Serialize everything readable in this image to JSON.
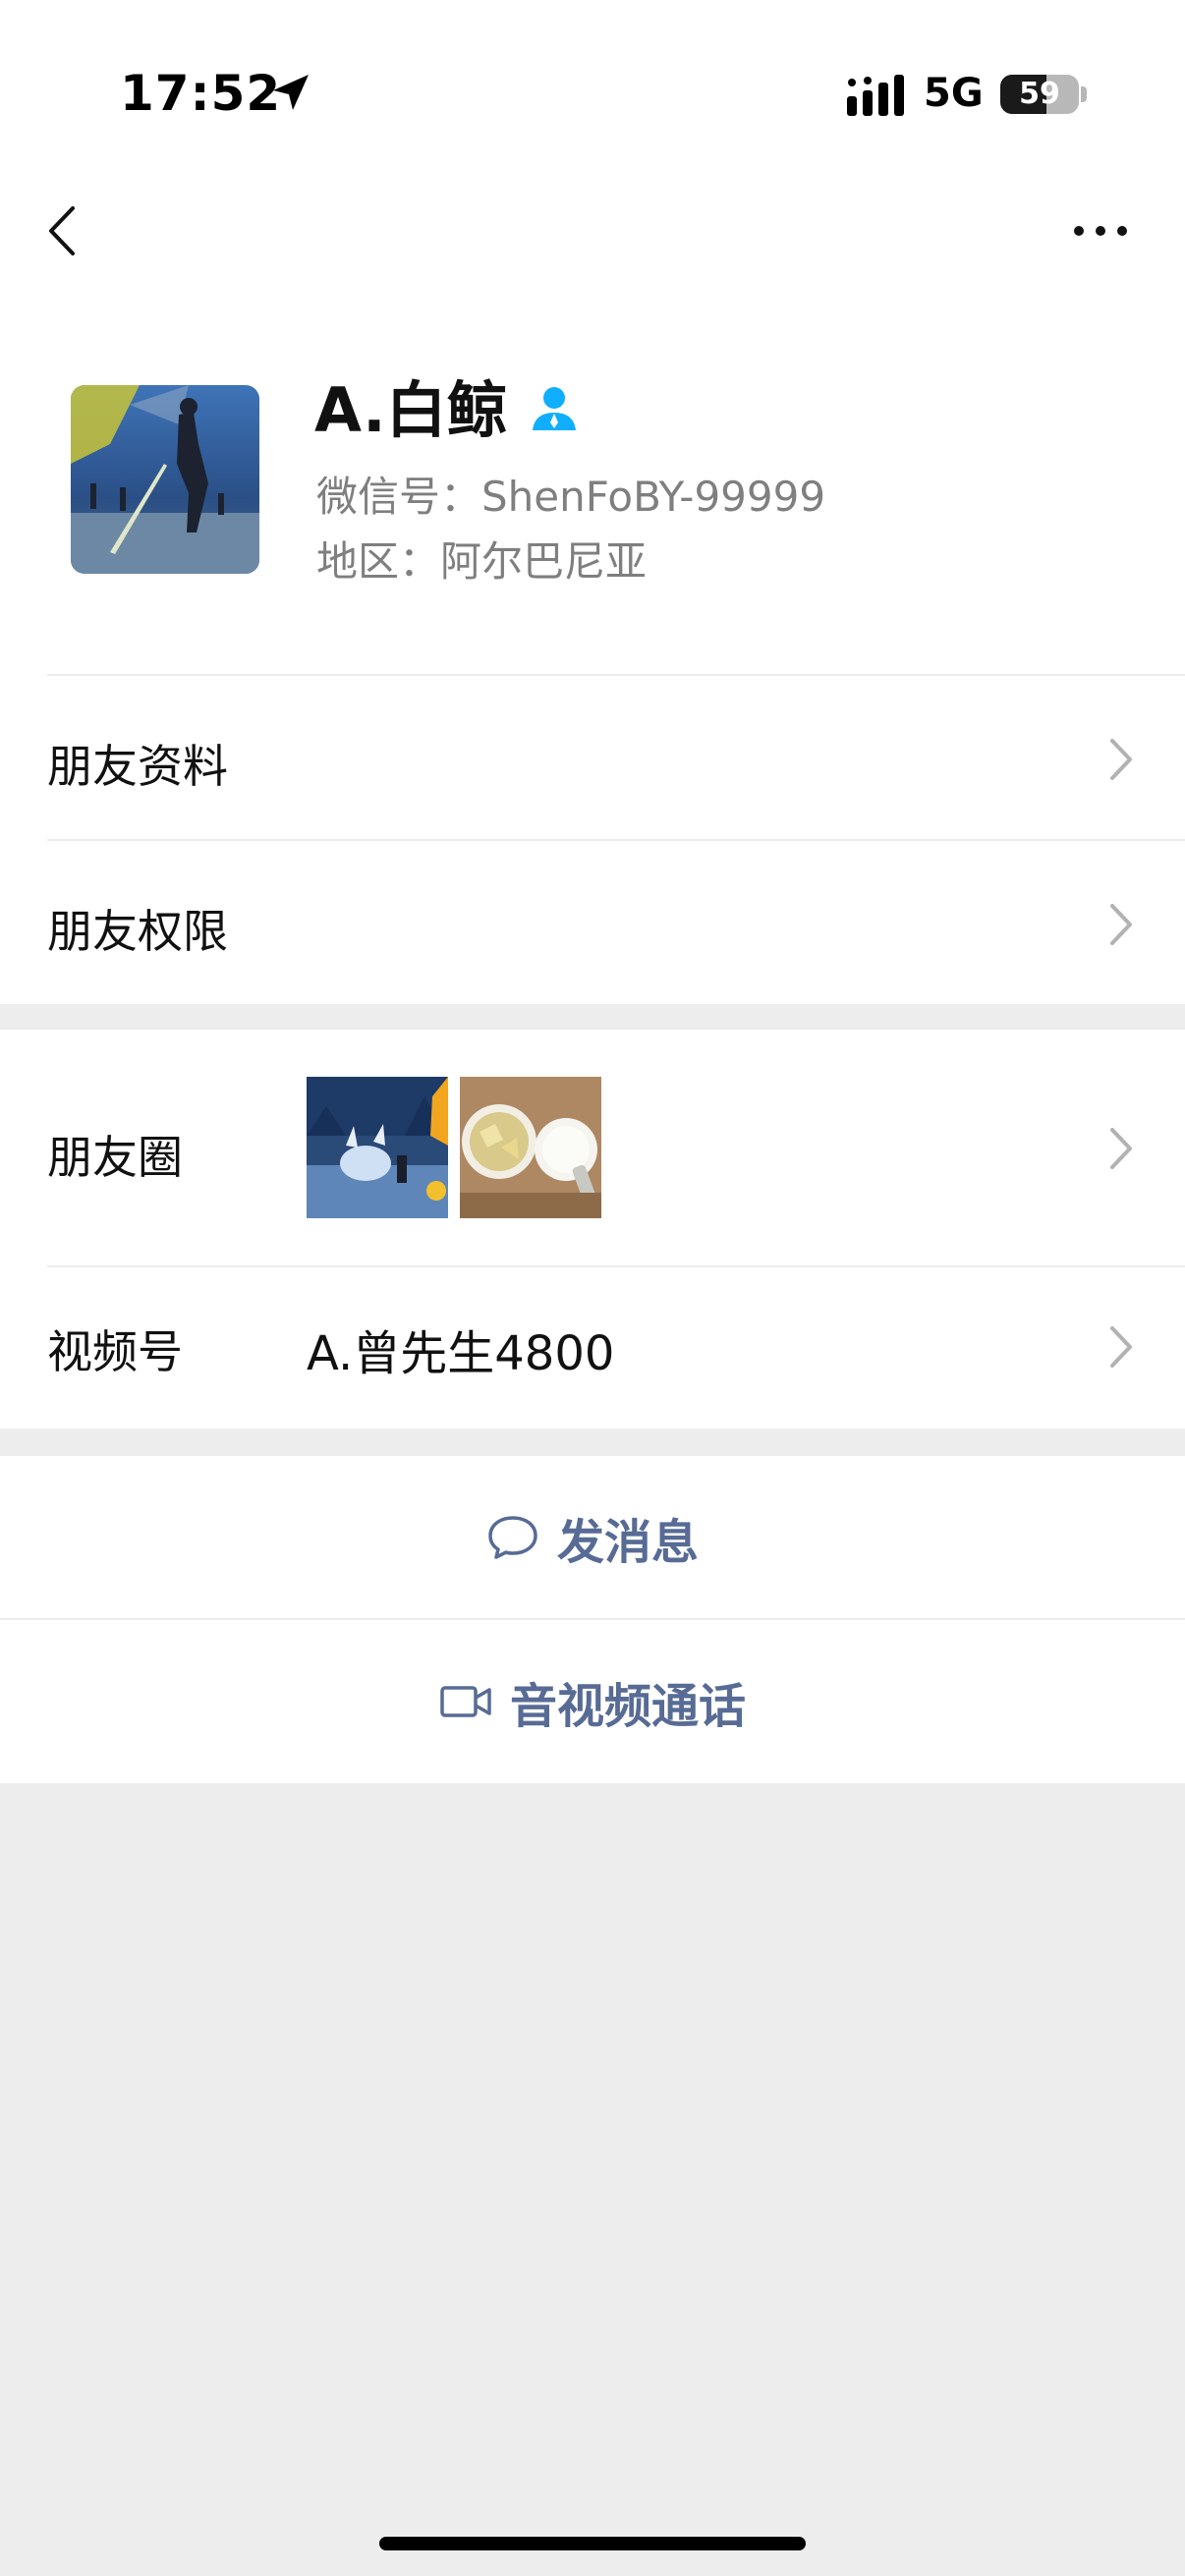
{
  "status_bar": {
    "time": "17:52",
    "network": "5G",
    "battery": "59",
    "battery_level": 0.59
  },
  "profile": {
    "name": "A.白鲸",
    "wechat_id": "微信号：ShenFoBY-99999",
    "region": "地区：阿尔巴尼亚"
  },
  "menu": {
    "friend_info": "朋友资料",
    "friend_permissions": "朋友权限",
    "moments": "朋友圈",
    "channels": "视频号",
    "channels_value": "A.曾先生4800"
  },
  "actions": {
    "message": "发消息",
    "call": "音视频通话"
  },
  "colors": {
    "link_blue": "#576b95",
    "verified_blue": "#10aeff",
    "background": "#ededed"
  },
  "icons": [
    "location-arrow-icon",
    "signal-icon",
    "battery-icon",
    "back-chevron-icon",
    "more-dots-icon",
    "person-icon",
    "chevron-right-icon",
    "chat-bubble-icon",
    "video-camera-icon"
  ]
}
